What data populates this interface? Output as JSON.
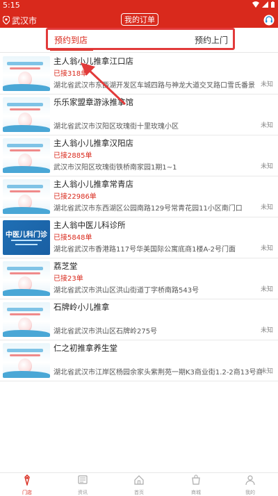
{
  "status_bar": {
    "time": "5:15"
  },
  "header": {
    "city": "武汉市",
    "orders_label": "我的订单"
  },
  "tabs": [
    {
      "label": "预约到店",
      "active": true
    },
    {
      "label": "预约上门",
      "active": false
    }
  ],
  "stores": [
    {
      "name": "主人翁小儿推拿江口店",
      "count": "已接318单",
      "address": "湖北省武汉市东西湖开发区车城四路与神龙大道交叉路口雪氏番景",
      "distance": "未知",
      "thumb": "poster"
    },
    {
      "name": "乐乐家盟章游泳推拿馆",
      "count": "",
      "address": "湖北省武汉市汉阳区玫瑰街十里玫瑰小区",
      "distance": "未知",
      "thumb": "poster"
    },
    {
      "name": "主人翁小儿推拿汉阳店",
      "count": "已接2885单",
      "address": "武汉市汉阳区玫瑰街铁桥南家园1期1~1",
      "distance": "未知",
      "thumb": "poster"
    },
    {
      "name": "主人翁小儿推拿常青店",
      "count": "已接22986单",
      "address": "湖北省武汉市东西湖区公园南路129号常青花园11小区南门口",
      "distance": "未知",
      "thumb": "poster"
    },
    {
      "name": "主人翁中医儿科诊所",
      "count": "已接5848单",
      "address": "湖北省武汉市香港路117号华美国际公寓底商1楼A-2号门面",
      "distance": "未知",
      "thumb": "tcm"
    },
    {
      "name": "荔芝堂",
      "count": "已接23单",
      "address": "湖北省武汉市洪山区洪山街道丁字桥南路543号",
      "distance": "未知",
      "thumb": "poster"
    },
    {
      "name": "石牌岭小儿推拿",
      "count": "",
      "address": "湖北省武汉市洪山区石牌岭275号",
      "distance": "未知",
      "thumb": "poster"
    },
    {
      "name": "仁之初推拿养生堂",
      "count": "",
      "address": "湖北省武汉市江岸区杨园余家头紫荆苑一期K3商业街1.2-2商13号商铺",
      "distance": "未知",
      "thumb": "poster"
    }
  ],
  "bottom_nav": [
    {
      "label": "门店",
      "icon": "store-icon",
      "active": true
    },
    {
      "label": "资讯",
      "icon": "news-icon",
      "active": false
    },
    {
      "label": "首页",
      "icon": "home-icon",
      "active": false
    },
    {
      "label": "商城",
      "icon": "shop-icon",
      "active": false
    },
    {
      "label": "我的",
      "icon": "profile-icon",
      "active": false
    }
  ],
  "colors": {
    "brand": "#d9291c",
    "annotation": "#e23a3a"
  }
}
